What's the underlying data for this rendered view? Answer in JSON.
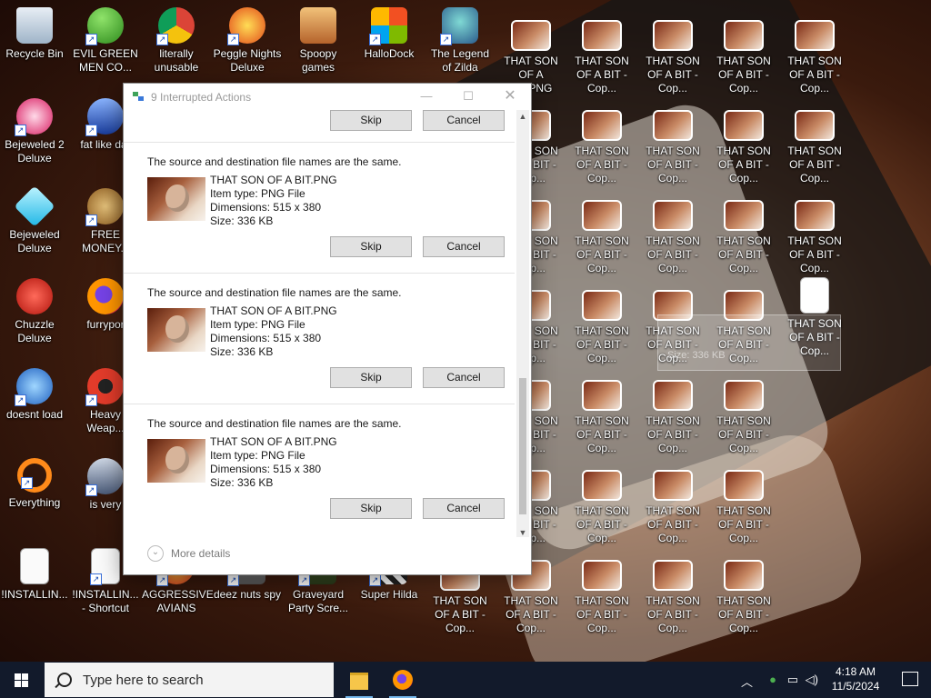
{
  "desktop": {
    "icons": [
      {
        "label": "Recycle Bin"
      },
      {
        "label": "EVIL GREEN MEN CO..."
      },
      {
        "label": "literally unusable"
      },
      {
        "label": "Peggle Nights Deluxe"
      },
      {
        "label": "Spoopy games"
      },
      {
        "label": "HalloDock"
      },
      {
        "label": "The Legend of Zilda"
      },
      {
        "label": "THAT SON OF A BIT.PNG"
      },
      {
        "label": "THAT SON OF A BIT - Cop..."
      },
      {
        "label": "Bejeweled 2 Deluxe"
      },
      {
        "label": "fat like dar"
      },
      {
        "label": "Bejeweled Deluxe"
      },
      {
        "label": "FREE MONEY.c"
      },
      {
        "label": "Chuzzle Deluxe"
      },
      {
        "label": "furrypor"
      },
      {
        "label": "doesnt load"
      },
      {
        "label": "Heavy Weap..."
      },
      {
        "label": "Everything"
      },
      {
        "label": "is very"
      },
      {
        "label": "!INSTALLIN..."
      },
      {
        "label": "!INSTALLIN... - Shortcut"
      },
      {
        "label": "AGGRESSIVE AVIANS"
      },
      {
        "label": "deez nuts spy"
      },
      {
        "label": "Graveyard Party Scre..."
      },
      {
        "label": "Super Hilda"
      }
    ],
    "ghost_text": "Size: 336 KB"
  },
  "dialog": {
    "title": "9 Interrupted Actions",
    "conflicts": [
      {
        "message": "The source and destination file names are the same.",
        "name": "THAT SON OF A BIT.PNG",
        "type": "Item type: PNG File",
        "dimensions": "Dimensions: 515 x 380",
        "size": "Size: 336 KB"
      },
      {
        "message": "The source and destination file names are the same.",
        "name": "THAT SON OF A BIT.PNG",
        "type": "Item type: PNG File",
        "dimensions": "Dimensions: 515 x 380",
        "size": "Size: 336 KB"
      },
      {
        "message": "The source and destination file names are the same.",
        "name": "THAT SON OF A BIT.PNG",
        "type": "Item type: PNG File",
        "dimensions": "Dimensions: 515 x 380",
        "size": "Size: 336 KB"
      }
    ],
    "skip_label": "Skip",
    "cancel_label": "Cancel",
    "more_details": "More details"
  },
  "taskbar": {
    "search_placeholder": "Type here to search",
    "time": "4:18 AM",
    "date": "11/5/2024"
  }
}
